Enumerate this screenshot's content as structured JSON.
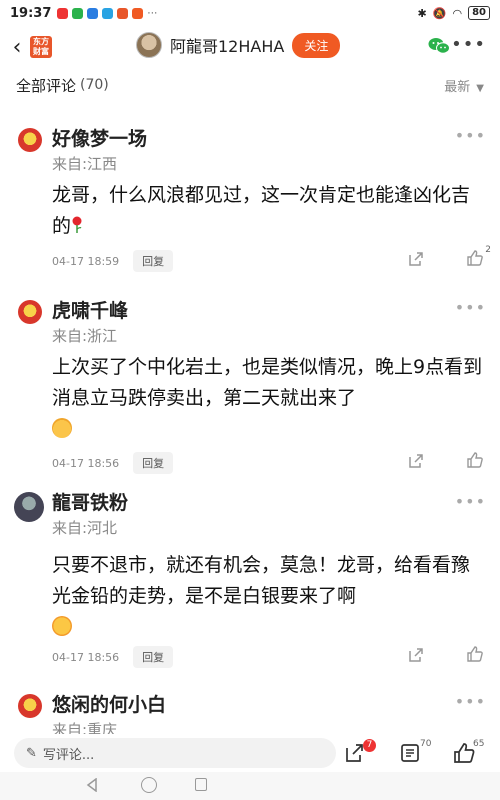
{
  "status_bar": {
    "time": "19:37",
    "battery": "80"
  },
  "header": {
    "app_logo": "东方\n财富",
    "user_name": "阿龍哥12HAHA",
    "follow_label": "关注"
  },
  "section": {
    "title": "全部评论",
    "count": "(70)",
    "sort_label": "最新"
  },
  "comments": [
    {
      "name": "好像梦一场",
      "from": "来自:江西",
      "text": "龙哥，什么风浪都见过，这一次肯定也能逢凶化吉的",
      "date": "04-17 18:59",
      "reply_label": "回复",
      "likes": "2"
    },
    {
      "name": "虎啸千峰",
      "from": "来自:浙江",
      "text": "上次买了个中化岩土，也是类似情况，晚上9点看到消息立马跌停卖出，第二天就出来了",
      "date": "04-17 18:56",
      "reply_label": "回复",
      "likes": ""
    },
    {
      "name": "龍哥铁粉",
      "from": "来自:河北",
      "text": "只要不退市，就还有机会，莫急！龙哥，给看看豫光金铅的走势，是不是白银要来了啊",
      "date": "04-17 18:56",
      "reply_label": "回复",
      "likes": ""
    },
    {
      "name": "悠闲的何小白",
      "from": "来自:重庆"
    }
  ],
  "bottom_bar": {
    "input_placeholder": "写评论...",
    "share_badge": "7",
    "comment_count": "70",
    "like_count": "65"
  }
}
